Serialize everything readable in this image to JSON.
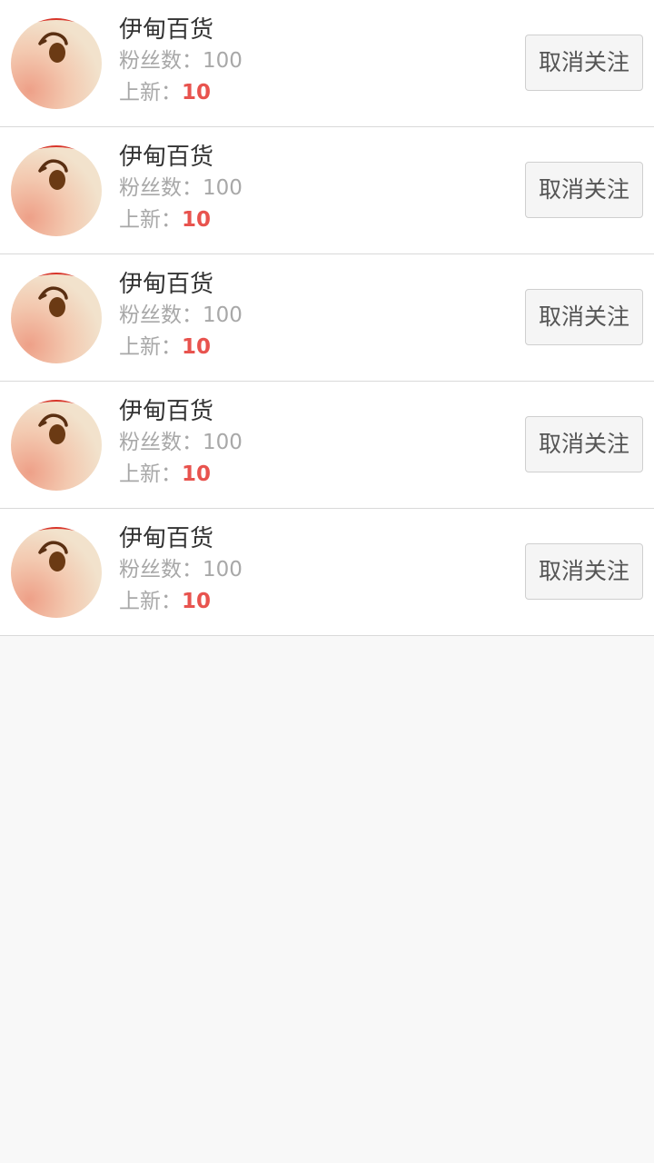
{
  "colors": {
    "page_background": "#f8f8f8",
    "accent_red": "#e8534e",
    "muted_text": "#a8a8a8"
  },
  "shops": [
    {
      "name": "伊甸百货",
      "fans_label": "粉丝数：",
      "fans_count": "100",
      "new_label": "上新：",
      "new_count": "10",
      "button_label": "取消关注"
    },
    {
      "name": "伊甸百货",
      "fans_label": "粉丝数：",
      "fans_count": "100",
      "new_label": "上新：",
      "new_count": "10",
      "button_label": "取消关注"
    },
    {
      "name": "伊甸百货",
      "fans_label": "粉丝数：",
      "fans_count": "100",
      "new_label": "上新：",
      "new_count": "10",
      "button_label": "取消关注"
    },
    {
      "name": "伊甸百货",
      "fans_label": "粉丝数：",
      "fans_count": "100",
      "new_label": "上新：",
      "new_count": "10",
      "button_label": "取消关注"
    },
    {
      "name": "伊甸百货",
      "fans_label": "粉丝数：",
      "fans_count": "100",
      "new_label": "上新：",
      "new_count": "10",
      "button_label": "取消关注"
    }
  ]
}
